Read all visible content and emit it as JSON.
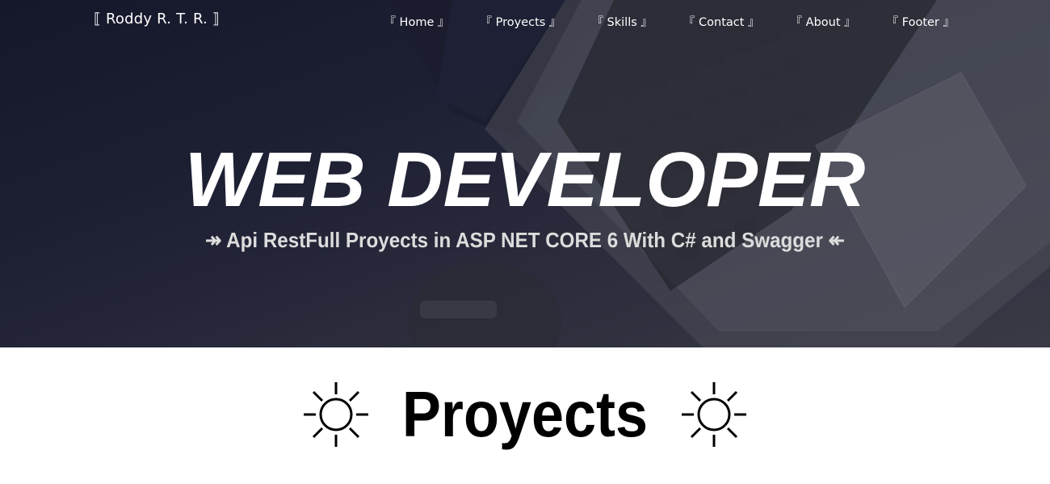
{
  "navbar": {
    "brand": "⟦ Roddy R. T. R. ⟧",
    "links": [
      {
        "label": "『 Home 』"
      },
      {
        "label": "『 Proyects 』"
      },
      {
        "label": "『 Skills 』"
      },
      {
        "label": "『 Contact 』"
      },
      {
        "label": "『 About 』"
      },
      {
        "label": "『 Footer 』"
      }
    ]
  },
  "hero": {
    "title": "WEB DEVELOPER",
    "subtitle": "↠ Api RestFull Proyects in ASP NET CORE 6 With C# and Swagger ↞",
    "background_icon": "laptop-keyboard-photo"
  },
  "proyects_section": {
    "title": "Proyects",
    "left_icon": "sun-icon",
    "right_icon": "sun-icon"
  }
}
